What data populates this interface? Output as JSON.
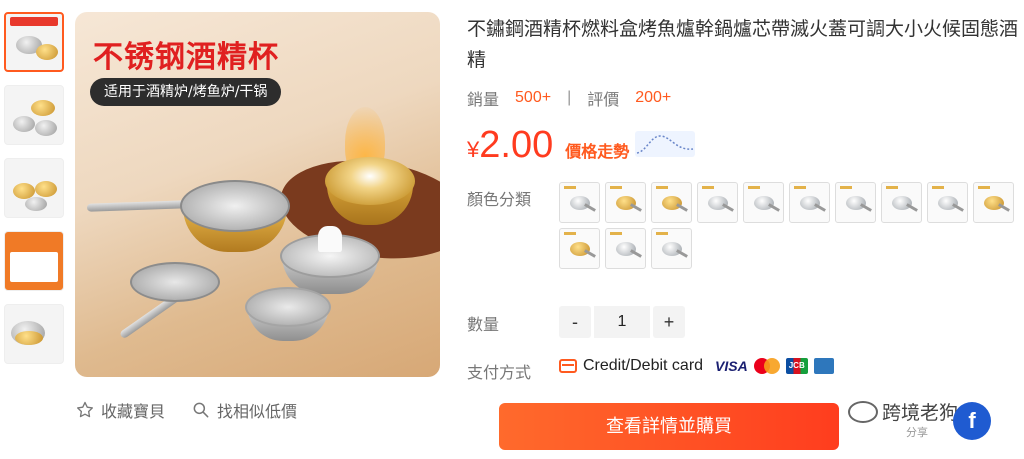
{
  "thumbnails": [
    {
      "kind": "banner",
      "active": true
    },
    {
      "kind": "pans",
      "active": false
    },
    {
      "kind": "variants",
      "active": false
    },
    {
      "kind": "orange",
      "active": false
    },
    {
      "kind": "single",
      "active": false
    }
  ],
  "main_image": {
    "headline": "不锈钢酒精杯",
    "subtitle": "适用于酒精炉/烤鱼炉/干锅"
  },
  "actions": {
    "favorite_label": "收藏寶貝",
    "similar_label": "找相似低價"
  },
  "product": {
    "title": "不鏽鋼酒精杯燃料盒烤魚爐幹鍋爐芯帶滅火蓋可調大小火候固態酒精",
    "sales_label": "銷量",
    "sales_value": "500+",
    "reviews_label": "評價",
    "reviews_value": "200+",
    "price_currency": "¥",
    "price_value": "2.00",
    "price_trend_label": "價格走勢"
  },
  "options": {
    "color_label": "顏色分類",
    "swatches": [
      "silver",
      "gold",
      "gold",
      "silver",
      "silver",
      "silver",
      "silver",
      "silver",
      "silver",
      "gold",
      "gold",
      "silver",
      "silver"
    ]
  },
  "quantity": {
    "label": "數量",
    "minus": "-",
    "value": "1",
    "plus": "+"
  },
  "payment": {
    "label": "支付方式",
    "method_text": "Credit/Debit card",
    "visa": "VISA",
    "jcb": "JCB"
  },
  "buy_button": "查看詳情並購買",
  "watermark": {
    "text": "跨境老狗",
    "share": "分享"
  },
  "colors": {
    "accent": "#ff5a1f",
    "price": "#ff3b1f"
  }
}
